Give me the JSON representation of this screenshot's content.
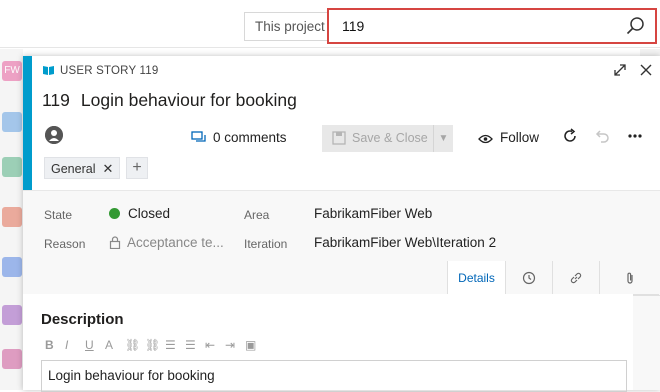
{
  "search": {
    "scope_label": "This project",
    "value": "119"
  },
  "work_item": {
    "type_label": "USER STORY 119",
    "id": "119",
    "title": "Login behaviour for booking",
    "comments_label": "0 comments",
    "save_close_label": "Save & Close",
    "follow_label": "Follow",
    "tags": [
      "General"
    ],
    "fields": {
      "state_label": "State",
      "state_value": "Closed",
      "reason_label": "Reason",
      "reason_value": "Acceptance te...",
      "area_label": "Area",
      "area_value": "FabrikamFiber Web",
      "iteration_label": "Iteration",
      "iteration_value": "FabrikamFiber Web\\Iteration 2"
    },
    "tabs": {
      "details_label": "Details"
    },
    "description": {
      "heading": "Description",
      "text": "Login behaviour for booking"
    }
  },
  "nav_rail": {
    "top_badge": "FW"
  },
  "colors": {
    "accent": "#009ccc",
    "search_border": "#d64541",
    "state_closed": "#339933",
    "active_tab": "#0066b8"
  }
}
